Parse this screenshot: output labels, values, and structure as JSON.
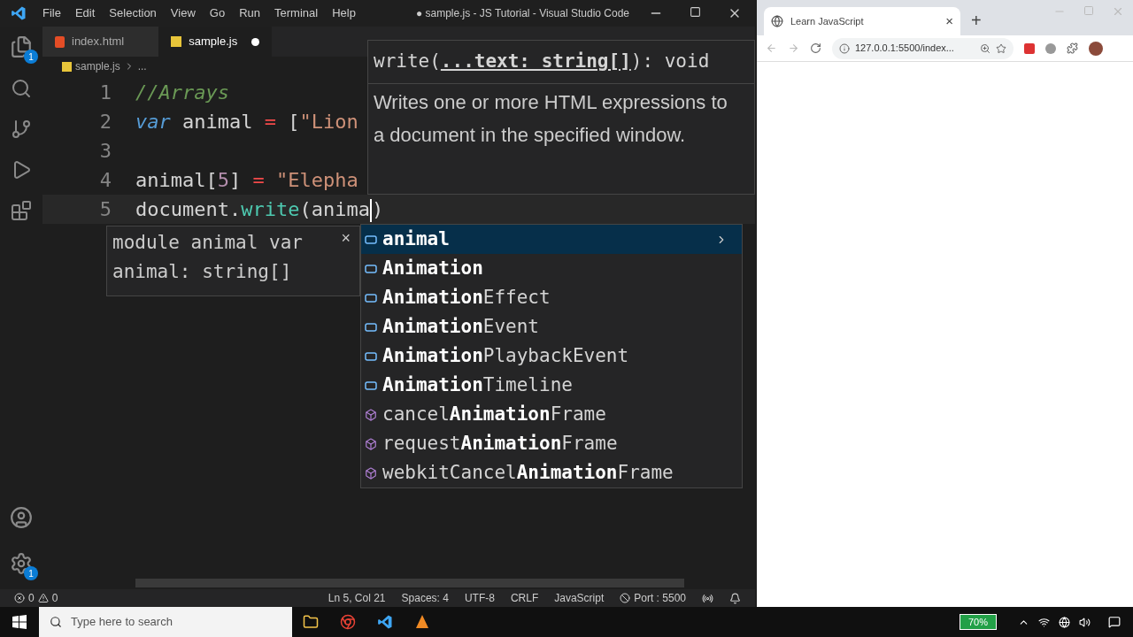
{
  "window": {
    "title": "● sample.js - JS Tutorial - Visual Studio Code",
    "menu": [
      "File",
      "Edit",
      "Selection",
      "View",
      "Go",
      "Run",
      "Terminal",
      "Help"
    ]
  },
  "activity_bar": {
    "explorer_badge": "1",
    "settings_badge": "1"
  },
  "tabs": [
    {
      "label": "index.html",
      "kind": "html",
      "selected": false,
      "modified": false
    },
    {
      "label": "sample.js",
      "kind": "js",
      "selected": true,
      "modified": true
    }
  ],
  "breadcrumb": [
    "sample.js",
    "..."
  ],
  "code": [
    {
      "number": "1",
      "tokens": [
        {
          "kind": "comment",
          "text": "//Arrays"
        }
      ]
    },
    {
      "number": "2",
      "tokens": [
        {
          "kind": "keyword",
          "text": "var"
        },
        {
          "kind": "ident",
          "text": " animal "
        },
        {
          "kind": "operator",
          "text": "="
        },
        {
          "kind": "punct",
          "text": " ["
        },
        {
          "kind": "string",
          "text": "\"Lion"
        }
      ]
    },
    {
      "number": "3"
    },
    {
      "number": "4",
      "tokens": [
        {
          "kind": "ident",
          "text": "animal"
        },
        {
          "kind": "punct",
          "text": "["
        },
        {
          "kind": "number",
          "text": "5"
        },
        {
          "kind": "punct",
          "text": "] "
        },
        {
          "kind": "operator",
          "text": "="
        },
        {
          "kind": "string",
          "text": " \"Elepha"
        }
      ]
    },
    {
      "number": "5",
      "tokens": [
        {
          "kind": "ident",
          "text": "document."
        },
        {
          "kind": "function",
          "text": "write"
        },
        {
          "kind": "punct",
          "text": "("
        },
        {
          "kind": "ident",
          "text": "anima"
        },
        {
          "kind": "cursor"
        },
        {
          "kind": "punct",
          "text": ")"
        }
      ]
    }
  ],
  "hover": {
    "signature_prefix": "write(",
    "signature_param": "...text: string[]",
    "signature_suffix": "): void",
    "documentation": "Writes one or more HTML expressions to a document in the specified window."
  },
  "details": {
    "text": "module animal var\nanimal: string[]",
    "close": "×"
  },
  "suggestions": [
    {
      "label": "**animal**",
      "kind": "variable",
      "selected": true
    },
    {
      "label": "**Animation**",
      "kind": "variable",
      "selected": false
    },
    {
      "label": "**Animation**Effect",
      "kind": "variable",
      "selected": false
    },
    {
      "label": "**Animation**Event",
      "kind": "variable",
      "selected": false
    },
    {
      "label": "**Animation**PlaybackEvent",
      "kind": "variable",
      "selected": false
    },
    {
      "label": "**Animation**Timeline",
      "kind": "variable",
      "selected": false
    },
    {
      "label": "cancel**Animation**Frame",
      "kind": "method",
      "selected": false
    },
    {
      "label": "request**Animation**Frame",
      "kind": "method",
      "selected": false
    },
    {
      "label": "webkitCancel**Animation**Frame",
      "kind": "method",
      "selected": false
    }
  ],
  "status_bar": {
    "errors": "0",
    "warnings": "0",
    "items": [
      "Ln 5, Col 21",
      "Spaces: 4",
      "UTF-8",
      "CRLF",
      "JavaScript"
    ],
    "port": "Port : 5500"
  },
  "browser": {
    "tab_title": "Learn JavaScript",
    "tab_close": "×",
    "new_tab": "+",
    "address": "127.0.0.1:5500/index..."
  },
  "taskbar": {
    "search_placeholder": "Type here to search",
    "battery": "70%"
  }
}
